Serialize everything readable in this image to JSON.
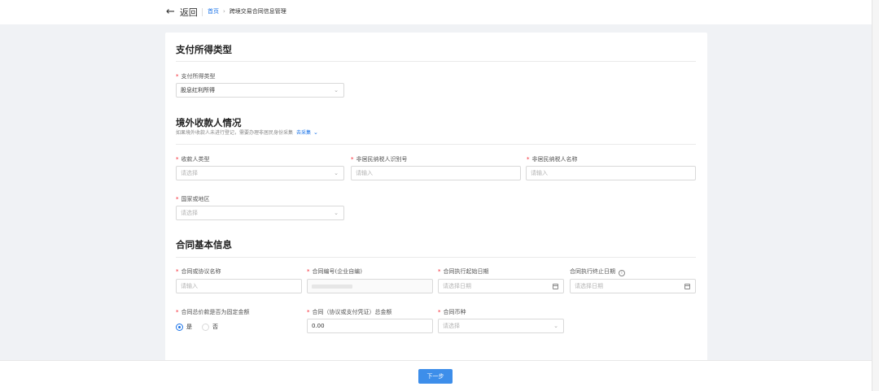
{
  "header": {
    "back_arrow": "←",
    "back_label": "返回",
    "breadcrumb_home": "首页",
    "breadcrumb_sep": "›",
    "breadcrumb_current": "跨境交易合同信息管理"
  },
  "section_payment": {
    "title": "支付所得类型",
    "payment_type_label": "支付所得类型",
    "payment_type_value": "股息红利所得"
  },
  "section_payee": {
    "title": "境外收款人情况",
    "note": "如果境外收款人未进行登记，需要办理非居民身份采集",
    "note_link": "去采集",
    "payee_type_label": "收款人类型",
    "payee_type_placeholder": "请选择",
    "tax_id_label": "非居民纳税人识别号",
    "tax_id_placeholder": "请输入",
    "taxpayer_name_label": "非居民纳税人名称",
    "taxpayer_name_placeholder": "请输入",
    "country_label": "国家或地区",
    "country_placeholder": "请选择"
  },
  "section_contract": {
    "title": "合同基本信息",
    "contract_name_label": "合同或协议名称",
    "contract_name_placeholder": "请输入",
    "contract_no_label": "合同编号(企业自编)",
    "start_date_label": "合同执行起始日期",
    "start_date_placeholder": "请选择日期",
    "end_date_label": "合同执行终止日期",
    "end_date_placeholder": "请选择日期",
    "fixed_amount_label": "合同总价款是否为固定金额",
    "radio_yes": "是",
    "radio_no": "否",
    "total_amount_label": "合同（协议或支付凭证）总金额",
    "total_amount_value": "0.00",
    "currency_label": "合同币种",
    "currency_placeholder": "请选择"
  },
  "footer": {
    "next_label": "下一步"
  },
  "colors": {
    "accent": "#1a73e8",
    "button": "#3d8eea",
    "required": "#f5222d"
  }
}
